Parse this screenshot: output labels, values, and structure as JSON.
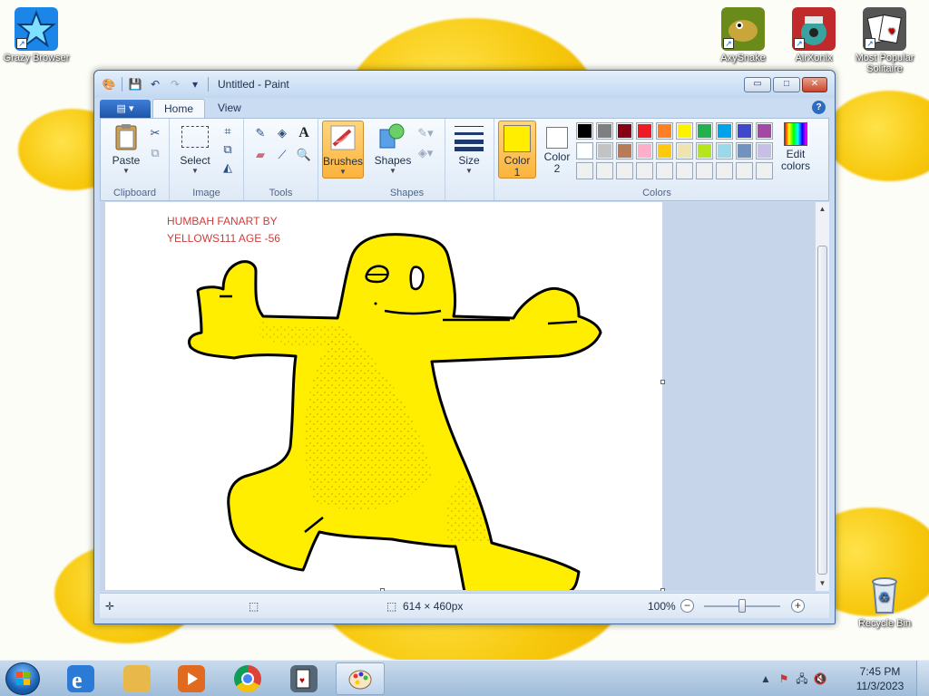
{
  "desktop": {
    "icons_left": [
      {
        "label": "Grazy Browser",
        "icon": "star-browser-icon",
        "color": "#1b86e8"
      }
    ],
    "icons_right": [
      {
        "label": "AxySnake",
        "icon": "snake-icon",
        "color": "#6a8a1a"
      },
      {
        "label": "AirXonix",
        "icon": "robot-icon",
        "color": "#c02a2a"
      },
      {
        "label": "Most Popular Solitaire",
        "icon": "cards-icon",
        "color": "#555555"
      }
    ],
    "recycle_bin": {
      "label": "Recycle Bin",
      "icon": "recycle-bin-icon"
    }
  },
  "window": {
    "title": "Untitled - Paint",
    "controls": {
      "minimize": "▭",
      "maximize": "□",
      "close": "✕"
    },
    "paint_menu_label": "▤ ▾",
    "tabs": [
      {
        "label": "Home",
        "active": true
      },
      {
        "label": "View",
        "active": false
      }
    ],
    "help": "?"
  },
  "ribbon": {
    "clipboard": {
      "label": "Clipboard",
      "paste": "Paste"
    },
    "image": {
      "label": "Image",
      "select": "Select"
    },
    "tools": {
      "label": "Tools"
    },
    "brushes": {
      "label": "Brushes"
    },
    "shapes": {
      "label": "Shapes",
      "button": "Shapes"
    },
    "size": {
      "label": "Size"
    },
    "colors": {
      "label": "Colors",
      "color1": {
        "label_top": "Color",
        "label_bottom": "1",
        "value": "#ffee00"
      },
      "color2": {
        "label_top": "Color",
        "label_bottom": "2",
        "value": "#ffffff"
      },
      "edit_top": "Edit",
      "edit_bottom": "colors",
      "palette_row1": [
        "#000000",
        "#7f7f7f",
        "#880015",
        "#ed1c24",
        "#ff7f27",
        "#fff200",
        "#22b14c",
        "#00a2e8",
        "#3f48cc",
        "#a349a4"
      ],
      "palette_row2": [
        "#ffffff",
        "#c3c3c3",
        "#b97a57",
        "#ffaec9",
        "#ffc90e",
        "#efe4b0",
        "#b5e61d",
        "#99d9ea",
        "#7092be",
        "#c8bfe7"
      ],
      "palette_row3": [
        "#f0f0f0",
        "#f0f0f0",
        "#f0f0f0",
        "#f0f0f0",
        "#f0f0f0",
        "#f0f0f0",
        "#f0f0f0",
        "#f0f0f0",
        "#f0f0f0",
        "#f0f0f0"
      ]
    }
  },
  "canvas": {
    "text_line1": "HUMBAH FANART BY",
    "text_line2": "YELLOWS111 AGE -56",
    "fill_color": "#ffee00",
    "outline_color": "#000000"
  },
  "statusbar": {
    "canvas_size": "614 × 460px",
    "zoom": "100%"
  },
  "taskbar": {
    "apps": [
      {
        "name": "internet-explorer",
        "color": "#2b7ad6"
      },
      {
        "name": "file-explorer",
        "color": "#e8b94a"
      },
      {
        "name": "media-player",
        "color": "#e06a1f"
      },
      {
        "name": "chrome",
        "color": "#d94a3a"
      },
      {
        "name": "solitaire",
        "color": "#556677"
      },
      {
        "name": "paint",
        "color": "#3b79c4"
      }
    ],
    "time": "7:45 PM",
    "date": "11/3/2023"
  }
}
